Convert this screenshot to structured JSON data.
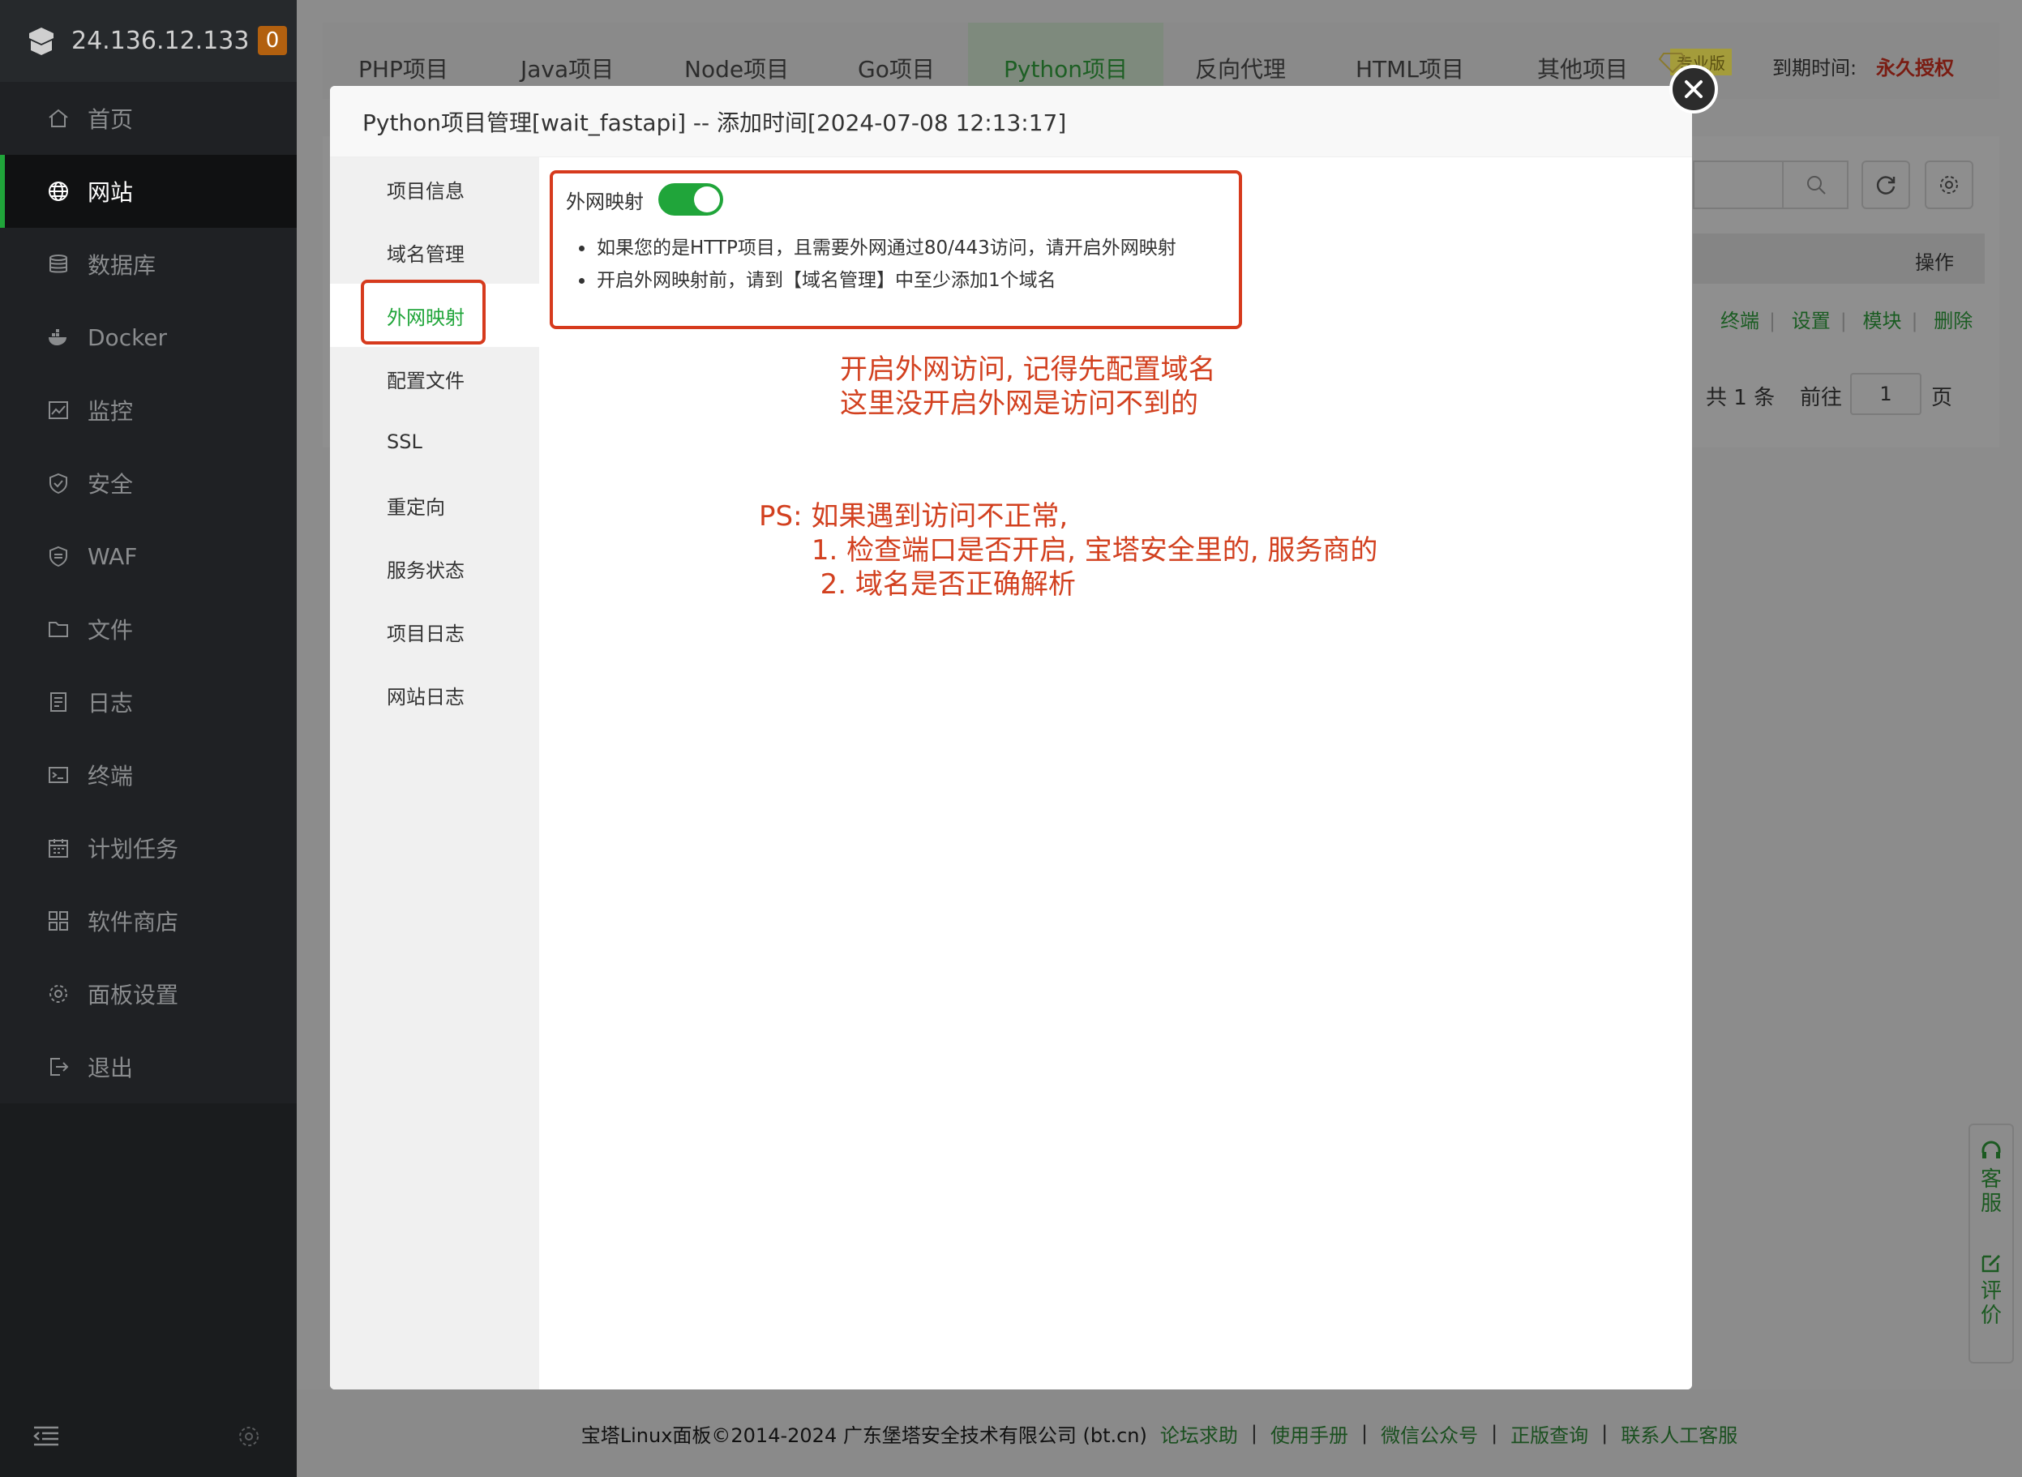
{
  "server": {
    "ip": "24.136.12.133",
    "message_count": "0"
  },
  "sidebar": {
    "items": [
      {
        "label": "首页",
        "icon": "home-icon"
      },
      {
        "label": "网站",
        "icon": "globe-icon",
        "active": true
      },
      {
        "label": "数据库",
        "icon": "database-icon"
      },
      {
        "label": "Docker",
        "icon": "docker-icon"
      },
      {
        "label": "监控",
        "icon": "monitor-icon"
      },
      {
        "label": "安全",
        "icon": "shield-icon"
      },
      {
        "label": "WAF",
        "icon": "waf-shield-icon"
      },
      {
        "label": "文件",
        "icon": "folder-icon"
      },
      {
        "label": "日志",
        "icon": "log-icon"
      },
      {
        "label": "终端",
        "icon": "terminal-icon"
      },
      {
        "label": "计划任务",
        "icon": "calendar-icon"
      },
      {
        "label": "软件商店",
        "icon": "apps-icon"
      },
      {
        "label": "面板设置",
        "icon": "gear-icon"
      },
      {
        "label": "退出",
        "icon": "logout-icon"
      }
    ]
  },
  "tabs": [
    {
      "label": "PHP项目"
    },
    {
      "label": "Java项目"
    },
    {
      "label": "Node项目"
    },
    {
      "label": "Go项目"
    },
    {
      "label": "Python项目",
      "active": true
    },
    {
      "label": "反向代理"
    },
    {
      "label": "HTML项目"
    },
    {
      "label": "其他项目"
    }
  ],
  "license": {
    "badge": "专业版",
    "expire_label": "到期时间:",
    "expire_value": "永久授权"
  },
  "table": {
    "op_header": "操作",
    "actions": [
      "终端",
      "设置",
      "模块",
      "删除"
    ]
  },
  "pager": {
    "total": "共 1 条",
    "goto": "前往",
    "page_value": "1",
    "page_suffix": "页"
  },
  "modal": {
    "title": "Python项目管理[wait_fastapi] -- 添加时间[2024-07-08 12:13:17]",
    "menu": [
      {
        "label": "项目信息"
      },
      {
        "label": "域名管理"
      },
      {
        "label": "外网映射",
        "active": true
      },
      {
        "label": "配置文件"
      },
      {
        "label": "SSL"
      },
      {
        "label": "重定向"
      },
      {
        "label": "服务状态"
      },
      {
        "label": "项目日志"
      },
      {
        "label": "网站日志"
      }
    ],
    "mapping_label": "外网映射",
    "mapping_enabled": true,
    "tips": [
      "如果您的是HTTP项目，且需要外网通过80/443访问，请开启外网映射",
      "开启外网映射前，请到【域名管理】中至少添加1个域名"
    ]
  },
  "annotations": {
    "note1": "开启外网访问, 记得先配置域名\n这里没开启外网是访问不到的",
    "note2": "PS: 如果遇到访问不正常,\n      1. 检查端口是否开启, 宝塔安全里的, 服务商的\n       2. 域名是否正确解析",
    "color": "#d2401f"
  },
  "footer": {
    "copyright": "宝塔Linux面板©2014-2024 广东堡塔安全技术有限公司 (bt.cn)",
    "links": [
      "论坛求助",
      "使用手册",
      "微信公众号",
      "正版查询",
      "联系人工客服"
    ]
  },
  "float_help": {
    "service": "客服",
    "review": "评价"
  }
}
